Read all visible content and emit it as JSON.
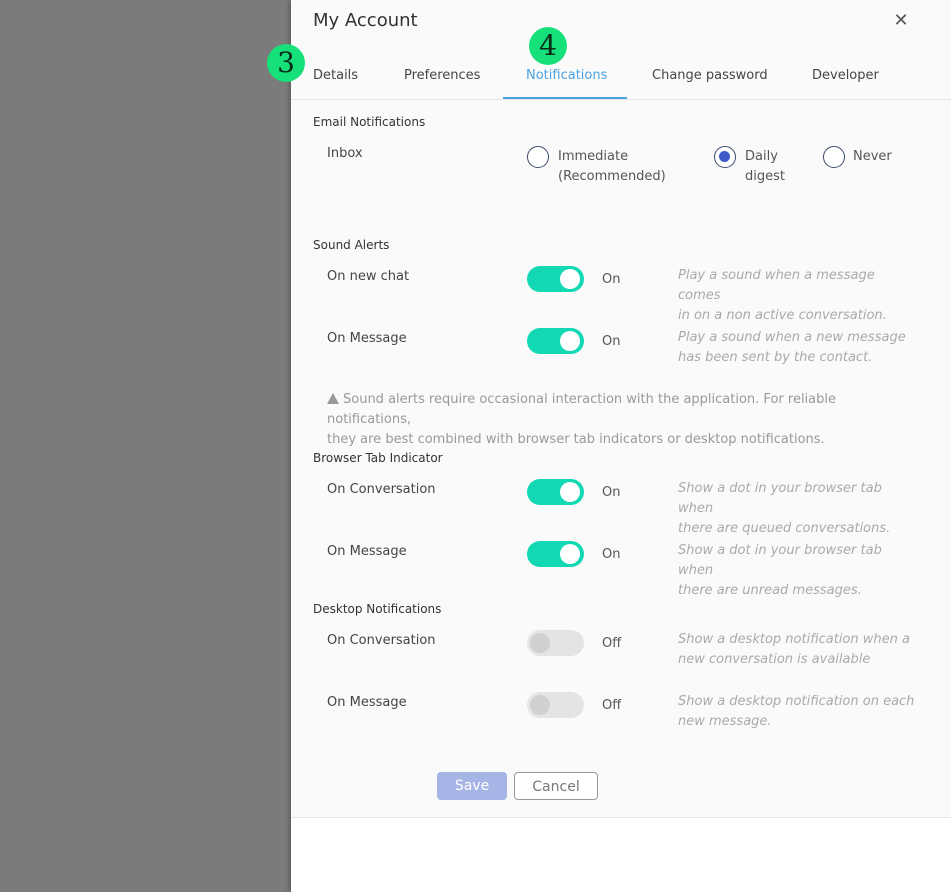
{
  "header": {
    "title": "My Account",
    "close_icon": "close-icon"
  },
  "tabs": [
    {
      "label": "Details"
    },
    {
      "label": "Preferences"
    },
    {
      "label": "Notifications",
      "active": true
    },
    {
      "label": "Change password"
    },
    {
      "label": "Developer"
    }
  ],
  "badges": [
    "3",
    "4"
  ],
  "email": {
    "title": "Email Notifications",
    "row_label": "Inbox",
    "options": [
      {
        "line1": "Immediate",
        "line2": "(Recommended)",
        "checked": false
      },
      {
        "line1": "Daily",
        "line2": "digest",
        "checked": true
      },
      {
        "line1": "Never",
        "line2": "",
        "checked": false
      }
    ]
  },
  "sound": {
    "title": "Sound Alerts",
    "rows": [
      {
        "label": "On new chat",
        "state": "On",
        "desc1": "Play a sound when a message comes",
        "desc2": "in on a non active conversation."
      },
      {
        "label": "On Message",
        "state": "On",
        "desc1": "Play a sound when a new message",
        "desc2": "has been sent by the contact."
      }
    ],
    "note1": "Sound alerts require occasional interaction with the application. For reliable notifications,",
    "note2": "they are best combined with browser tab indicators or desktop notifications."
  },
  "browser": {
    "title": "Browser Tab Indicator",
    "rows": [
      {
        "label": "On Conversation",
        "state": "On",
        "desc1": "Show a dot in your browser tab when",
        "desc2": "there are queued conversations."
      },
      {
        "label": "On Message",
        "state": "On",
        "desc1": "Show a dot in your browser tab when",
        "desc2": "there are unread messages."
      }
    ]
  },
  "desktop": {
    "title": "Desktop Notifications",
    "rows": [
      {
        "label": "On Conversation",
        "state": "Off",
        "desc1": "Show a desktop notification when a",
        "desc2": "new conversation is available"
      },
      {
        "label": "On Message",
        "state": "Off",
        "desc1": "Show a desktop notification on each",
        "desc2": "new message."
      }
    ]
  },
  "actions": {
    "save": "Save",
    "cancel": "Cancel"
  },
  "colors": {
    "accent": "#4aa3df",
    "toggle_on": "#12d9b4",
    "radio": "#3d5ac8",
    "badge": "#15e07a"
  }
}
